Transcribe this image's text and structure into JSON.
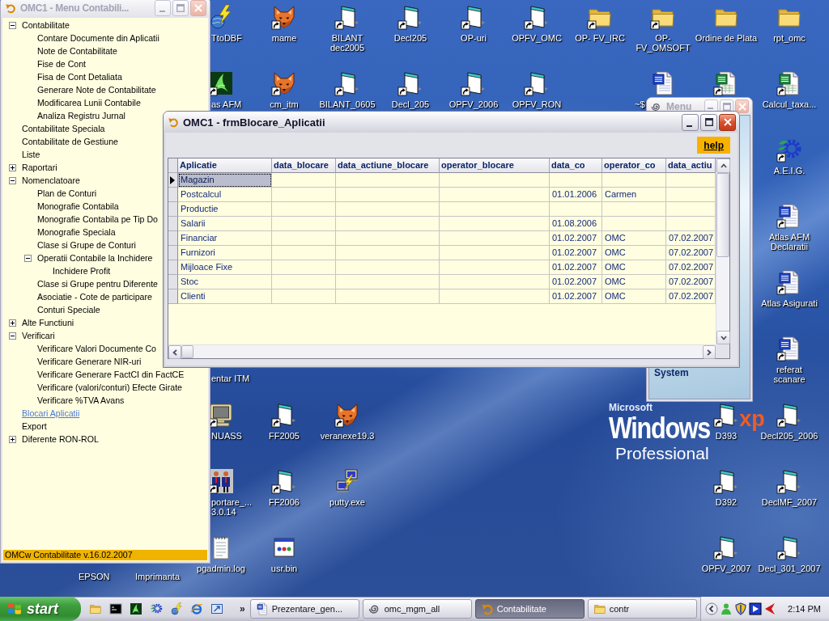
{
  "menu_window": {
    "title": "OMC1 - Menu Contabili...",
    "active": false,
    "tree": [
      {
        "label": "Contabilitate",
        "expanded": true,
        "selected": false,
        "children": [
          {
            "label": "Contare Documente din Aplicatii",
            "selected": false
          },
          {
            "label": "Note de Contabilitate",
            "selected": false
          },
          {
            "label": "Fise de Cont",
            "selected": false
          },
          {
            "label": "Fisa de Cont Detaliata",
            "selected": false
          },
          {
            "label": "Generare Note de Contabilitate",
            "selected": false
          },
          {
            "label": "Modificarea Lunii Contabile",
            "selected": false
          },
          {
            "label": "Analiza Registru Jurnal",
            "selected": false
          }
        ]
      },
      {
        "label": "Contabilitate Speciala",
        "selected": false
      },
      {
        "label": "Contabilitate de Gestiune",
        "selected": false
      },
      {
        "label": "Liste",
        "selected": false
      },
      {
        "label": "Raportari",
        "expanded": false,
        "selected": false
      },
      {
        "label": "Nomenclatoare",
        "expanded": true,
        "selected": false,
        "children": [
          {
            "label": "Plan de Conturi",
            "selected": false
          },
          {
            "label": "Monografie Contabila",
            "selected": false
          },
          {
            "label": "Monografie Contabila pe Tip Do",
            "selected": false
          },
          {
            "label": "Monografie Speciala",
            "selected": false
          },
          {
            "label": "Clase si Grupe de Conturi",
            "selected": false
          },
          {
            "label": "Operatii Contabile la Inchidere",
            "expanded": true,
            "selected": false,
            "children": [
              {
                "label": "Inchidere Profit",
                "selected": false
              }
            ]
          },
          {
            "label": "Clase si Grupe pentru Diferente",
            "selected": false
          },
          {
            "label": "Asociatie - Cote de participare",
            "selected": false
          },
          {
            "label": "Conturi Speciale",
            "selected": false
          }
        ]
      },
      {
        "label": "Alte Functiuni",
        "expanded": false,
        "selected": false
      },
      {
        "label": "Verificari",
        "expanded": true,
        "selected": false,
        "children": [
          {
            "label": "Verificare Valori Documente Co",
            "selected": false
          },
          {
            "label": "Verificare Generare NIR-uri",
            "selected": false
          },
          {
            "label": "Verificare Generare FactCI din FactCE",
            "selected": false
          },
          {
            "label": "Verificare (valori/conturi) Efecte Girate",
            "selected": false
          },
          {
            "label": "Verificare %TVA Avans",
            "selected": false
          }
        ]
      },
      {
        "label": "Blocari Aplicatii",
        "selected": true
      },
      {
        "label": "Export",
        "selected": false
      },
      {
        "label": "Diferente RON-ROL",
        "expanded": false,
        "selected": false
      }
    ],
    "status_bar": "OMCw Contabilitate v.16.02.2007"
  },
  "desktop": {
    "icons": [
      {
        "label": "TtoDBF",
        "kind": "lightning",
        "shortcut": false
      },
      {
        "label": "mame",
        "kind": "fox",
        "shortcut": true
      },
      {
        "label": "BILANT\ndec2005",
        "kind": "page",
        "shortcut": true
      },
      {
        "label": "Decl205",
        "kind": "page",
        "shortcut": true
      },
      {
        "label": "OP-uri",
        "kind": "page",
        "shortcut": true
      },
      {
        "label": "OPFV_OMC",
        "kind": "page",
        "shortcut": true
      },
      {
        "label": "OP- FV_IRC",
        "kind": "folder",
        "shortcut": true
      },
      {
        "label": "OP-\nFV_OMSOFT",
        "kind": "folder",
        "shortcut": true
      },
      {
        "label": "Ordine de Plata",
        "kind": "folder",
        "shortcut": false
      },
      {
        "label": "rpt_omc",
        "kind": "folder",
        "shortcut": false
      },
      {
        "label": "as AFM",
        "kind": "swirl-tile",
        "shortcut": true
      },
      {
        "label": "cm_itm",
        "kind": "fox",
        "shortcut": true
      },
      {
        "label": "BILANT_0605",
        "kind": "page",
        "shortcut": true
      },
      {
        "label": "Decl_205",
        "kind": "page",
        "shortcut": true
      },
      {
        "label": "OPFV_2006",
        "kind": "page",
        "shortcut": true
      },
      {
        "label": "OPFV_RON",
        "kind": "page",
        "shortcut": true
      },
      {
        "label": "~$",
        "kind": "document",
        "shortcut": false
      },
      {
        "kind": "spreadsheet",
        "shortcut": true
      },
      {
        "label": "Calcul_taxa...",
        "kind": "spreadsheet",
        "shortcut": true
      },
      {
        "label": "A.E.I.G.",
        "kind": "gear",
        "shortcut": true
      },
      {
        "label": "Atlas AFM\nDeclaratii",
        "kind": "document",
        "shortcut": true
      },
      {
        "label": "Atlas Asigurati",
        "kind": "document",
        "shortcut": true
      },
      {
        "label": "referat\nscanare",
        "kind": "document",
        "shortcut": true
      },
      {
        "label": "NUASS",
        "kind": "monitor",
        "shortcut": true
      },
      {
        "label": "FF2005",
        "kind": "page",
        "shortcut": true
      },
      {
        "label": "veranexe19.3",
        "kind": "fox",
        "shortcut": true
      },
      {
        "label": "D393",
        "kind": "page",
        "shortcut": true
      },
      {
        "label": "Decl205_2006",
        "kind": "page",
        "shortcut": true
      },
      {
        "label": "portare_...\n3.0.14",
        "kind": "people",
        "shortcut": true
      },
      {
        "label": "FF2006",
        "kind": "page",
        "shortcut": true
      },
      {
        "label": "putty.exe",
        "kind": "computers",
        "shortcut": false
      },
      {
        "label": "D392",
        "kind": "page",
        "shortcut": true
      },
      {
        "label": "DeclMF_2007",
        "kind": "page",
        "shortcut": true
      },
      {
        "label": "pgadmin.log",
        "kind": "notepad",
        "shortcut": false
      },
      {
        "label": "usr.bin",
        "kind": "app-window",
        "shortcut": false
      },
      {
        "label": "OPFV_2007",
        "kind": "page",
        "shortcut": true
      },
      {
        "label": "Decl_301_2007",
        "kind": "page",
        "shortcut": true
      }
    ],
    "partial_labels": [
      "entar ITM",
      "EPSON",
      "Imprimanta"
    ],
    "wallpaper_logo": {
      "brand": "Microsoft",
      "product": "Windows",
      "version": "xp",
      "edition": "Professional"
    }
  },
  "background_window": {
    "title": "Menu",
    "active": false,
    "caption": "System"
  },
  "table_window": {
    "title": "OMC1 - frmBlocare_Aplicatii",
    "active": true,
    "help_button": "help",
    "table": {
      "columns": [
        "Aplicatie",
        "data_blocare",
        "data_actiune_blocare",
        "operator_blocare",
        "data_co",
        "operator_co",
        "data_actiu"
      ],
      "rows": [
        {
          "selected": true,
          "cells": [
            "Magazin",
            null,
            null,
            null,
            null,
            null,
            null
          ]
        },
        {
          "selected": false,
          "cells": [
            "Postcalcul",
            null,
            null,
            null,
            "01.01.2006",
            "Carmen",
            null
          ]
        },
        {
          "selected": false,
          "cells": [
            "Productie",
            null,
            null,
            null,
            null,
            null,
            null
          ]
        },
        {
          "selected": false,
          "cells": [
            "Salarii",
            null,
            null,
            null,
            "01.08.2006",
            null,
            null
          ]
        },
        {
          "selected": false,
          "cells": [
            "Financiar",
            null,
            null,
            null,
            "01.02.2007",
            "OMC",
            "07.02.2007"
          ]
        },
        {
          "selected": false,
          "cells": [
            "Furnizori",
            null,
            null,
            null,
            "01.02.2007",
            "OMC",
            "07.02.2007"
          ]
        },
        {
          "selected": false,
          "cells": [
            "Mijloace Fixe",
            null,
            null,
            null,
            "01.02.2007",
            "OMC",
            "07.02.2007"
          ]
        },
        {
          "selected": false,
          "cells": [
            "Stoc",
            null,
            null,
            null,
            "01.02.2007",
            "OMC",
            "07.02.2007"
          ]
        },
        {
          "selected": false,
          "cells": [
            "Clienti",
            null,
            null,
            null,
            "01.02.2007",
            "OMC",
            "07.02.2007"
          ]
        }
      ]
    }
  },
  "taskbar": {
    "start_button": "start",
    "quick_launch": [
      {
        "kind": "folder"
      },
      {
        "kind": "console"
      },
      {
        "kind": "swirl-tile"
      },
      {
        "kind": "gear"
      },
      {
        "kind": "lightning"
      },
      {
        "kind": "browser"
      },
      {
        "kind": "arrow-window"
      }
    ],
    "more_button": "»",
    "tasks": [
      {
        "label": "Prezentare_gen...",
        "kind": "document",
        "selected": false
      },
      {
        "label": "omc_mgm_all",
        "kind": "spiral",
        "selected": false
      },
      {
        "label": "Contabilitate",
        "kind": "curved-arrow",
        "selected": true
      },
      {
        "label": "contr",
        "kind": "folder",
        "selected": false
      }
    ],
    "tray_icons": [
      {
        "kind": "chevron"
      },
      {
        "kind": "figure"
      },
      {
        "kind": "shield"
      },
      {
        "kind": "play"
      },
      {
        "kind": "wedge"
      }
    ],
    "clock": "2:14 PM"
  }
}
